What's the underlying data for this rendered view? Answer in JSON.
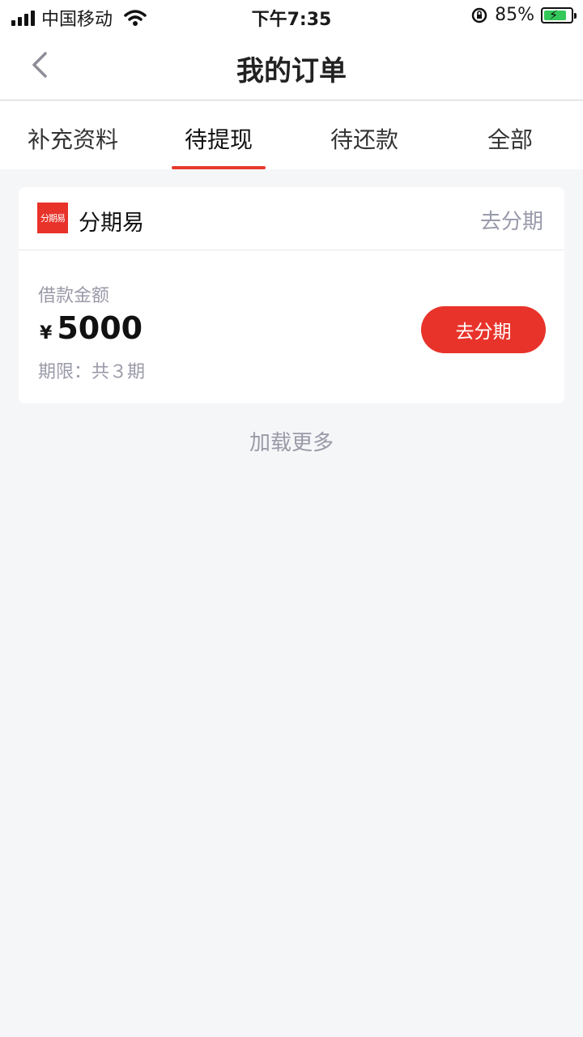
{
  "status_bar": {
    "carrier": "中国移动",
    "time": "下午7:35",
    "battery_percent": "85%"
  },
  "header": {
    "title": "我的订单"
  },
  "tabs": [
    {
      "label": "补充资料",
      "active": false
    },
    {
      "label": "待提现",
      "active": true
    },
    {
      "label": "待还款",
      "active": false
    },
    {
      "label": "全部",
      "active": false
    }
  ],
  "order_card": {
    "brand_logo_text": "分期易",
    "brand_name": "分期易",
    "head_link": "去分期",
    "amount_label": "借款金额",
    "currency": "¥",
    "amount": "5000",
    "term": "期限：共３期",
    "action_button": "去分期"
  },
  "load_more": "加载更多",
  "colors": {
    "accent": "#e8332a",
    "muted_text": "#9a9aa8",
    "background": "#f5f6f8"
  }
}
